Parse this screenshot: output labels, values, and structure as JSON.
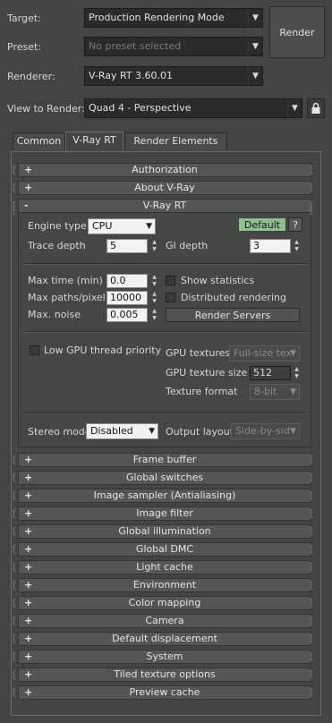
{
  "top": {
    "target_label": "Target:",
    "target_value": "Production Rendering Mode",
    "preset_label": "Preset:",
    "preset_value": "No preset selected",
    "renderer_label": "Renderer:",
    "renderer_value": "V-Ray RT 3.60.01",
    "view_label": "View to Render:",
    "view_value": "Quad 4 - Perspective",
    "render_button": "Render"
  },
  "tabs": [
    {
      "label": "Common"
    },
    {
      "label": "V-Ray RT",
      "active": true
    },
    {
      "label": "Render Elements"
    }
  ],
  "rollouts_top": [
    {
      "sign": "+",
      "label": "Authorization"
    },
    {
      "sign": "+",
      "label": "About V-Ray"
    },
    {
      "sign": "-",
      "label": "V-Ray RT"
    }
  ],
  "vrayrt": {
    "engine_label": "Engine type",
    "engine_value": "CPU",
    "default_button": "Default",
    "help_button": "?",
    "trace_depth_label": "Trace depth",
    "trace_depth_value": "5",
    "gi_depth_label": "GI depth",
    "gi_depth_value": "3",
    "max_time_label": "Max time (min)",
    "max_time_value": "0.0",
    "max_paths_label": "Max paths/pixel",
    "max_paths_value": "10000",
    "max_noise_label": "Max. noise",
    "max_noise_value": "0.005",
    "show_statistics_label": "Show statistics",
    "distributed_label": "Distributed rendering",
    "render_servers_button": "Render Servers",
    "low_gpu_label": "Low GPU thread priority",
    "gpu_textures_label": "GPU textures",
    "gpu_textures_value": "Full-size tex",
    "gpu_texture_size_label": "GPU texture size",
    "gpu_texture_size_value": "512",
    "texture_format_label": "Texture format",
    "texture_format_value": "8-bit",
    "stereo_mode_label": "Stereo mode",
    "stereo_mode_value": "Disabled",
    "output_layout_label": "Output layout",
    "output_layout_value": "Side-by-side"
  },
  "rollouts_bottom": [
    {
      "sign": "+",
      "label": "Frame buffer"
    },
    {
      "sign": "+",
      "label": "Global switches"
    },
    {
      "sign": "+",
      "label": "Image sampler (Antialiasing)"
    },
    {
      "sign": "+",
      "label": "Image filter"
    },
    {
      "sign": "+",
      "label": "Global illumination"
    },
    {
      "sign": "+",
      "label": "Global DMC"
    },
    {
      "sign": "+",
      "label": "Light cache"
    },
    {
      "sign": "+",
      "label": "Environment"
    },
    {
      "sign": "+",
      "label": "Color mapping"
    },
    {
      "sign": "+",
      "label": "Camera"
    },
    {
      "sign": "+",
      "label": "Default displacement"
    },
    {
      "sign": "+",
      "label": "System"
    },
    {
      "sign": "+",
      "label": "Tiled texture options"
    },
    {
      "sign": "+",
      "label": "Preview cache"
    }
  ],
  "colors": {
    "background": "#444444",
    "default_button": "#8fbf8f",
    "rollout": "#555555"
  }
}
